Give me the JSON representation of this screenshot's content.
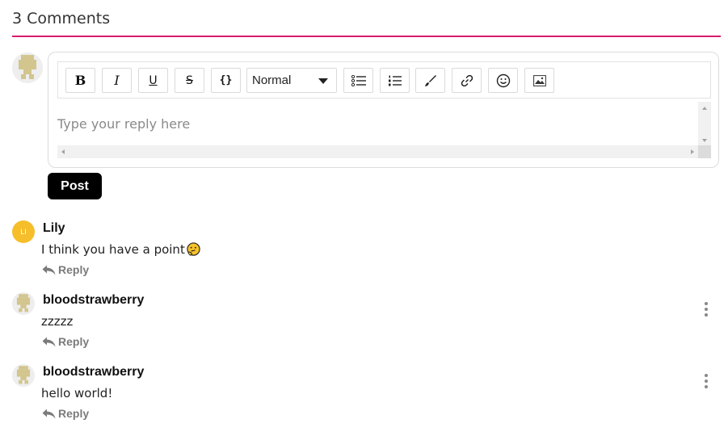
{
  "header": {
    "title": "3 Comments"
  },
  "editor": {
    "toolbar": {
      "bold": "B",
      "italic": "I",
      "underline": "U",
      "strike": "S",
      "code": "{}",
      "block_format": "Normal"
    },
    "placeholder": "Type your reply here"
  },
  "post_button": {
    "label": "Post"
  },
  "comments": [
    {
      "initials": "LI",
      "author": "Lily",
      "text": "I think you have a point",
      "reply_label": "Reply"
    },
    {
      "author": "bloodstrawberry",
      "text": "zzzzz",
      "reply_label": "Reply"
    },
    {
      "author": "bloodstrawberry",
      "text": "hello world!",
      "reply_label": "Reply"
    }
  ],
  "colors": {
    "accent": "#d81b6e",
    "initials_avatar": "#f5be2a",
    "identicon": "#d2c58e"
  },
  "icons": [
    "ordered-list-icon",
    "bullet-list-icon",
    "brush-icon",
    "link-icon",
    "emoji-icon",
    "image-icon",
    "reply-arrow-icon",
    "more-vertical-icon",
    "thinking-face-icon"
  ]
}
